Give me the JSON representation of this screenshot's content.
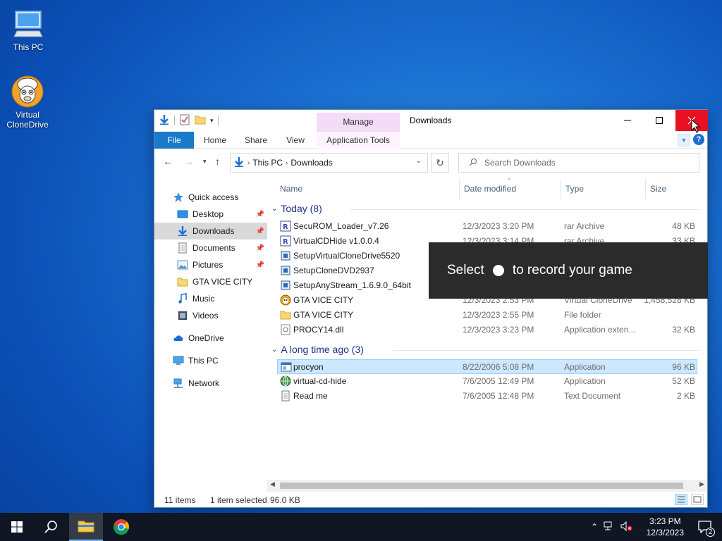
{
  "desktop": {
    "icons": [
      {
        "label": "This PC",
        "icon": "this-pc-icon"
      },
      {
        "label": "Virtual CloneDrive",
        "icon": "sheep-icon"
      }
    ]
  },
  "window": {
    "title": "Downloads",
    "context_tab_group": "Manage",
    "ribbon_tabs": [
      "File",
      "Home",
      "Share",
      "View",
      "Application Tools"
    ],
    "help_label": "?",
    "address": {
      "root": "This PC",
      "current": "Downloads"
    },
    "search_placeholder": "Search Downloads",
    "nav": [
      {
        "label": "Quick access",
        "icon": "star-icon"
      },
      {
        "label": "Desktop",
        "icon": "desktop-folder-icon",
        "pinned": true
      },
      {
        "label": "Downloads",
        "icon": "download-folder-icon",
        "pinned": true,
        "selected": true
      },
      {
        "label": "Documents",
        "icon": "documents-icon",
        "pinned": true
      },
      {
        "label": "Pictures",
        "icon": "pictures-icon",
        "pinned": true
      },
      {
        "label": "GTA VICE CITY",
        "icon": "folder-icon"
      },
      {
        "label": "Music",
        "icon": "music-icon"
      },
      {
        "label": "Videos",
        "icon": "videos-icon"
      },
      {
        "label": "OneDrive",
        "icon": "cloud-icon"
      },
      {
        "label": "This PC",
        "icon": "computer-icon"
      },
      {
        "label": "Network",
        "icon": "network-icon"
      }
    ],
    "columns": [
      "Name",
      "Date modified",
      "Type",
      "Size"
    ],
    "groups": [
      {
        "title": "Today (8)",
        "rows": [
          {
            "name": "SecuROM_Loader_v7.26",
            "date": "12/3/2023 3:20 PM",
            "type": "rar Archive",
            "size": "48 KB",
            "icon": "archive-icon"
          },
          {
            "name": "VirtualCDHide v1.0.0.4",
            "date": "12/3/2023 3:14 PM",
            "type": "rar Archive",
            "size": "33 KB",
            "icon": "archive-icon"
          },
          {
            "name": "SetupVirtualCloneDrive5520",
            "date": "",
            "type": "",
            "size": "",
            "icon": "installer-icon"
          },
          {
            "name": "SetupCloneDVD2937",
            "date": "",
            "type": "",
            "size": "",
            "icon": "installer-icon"
          },
          {
            "name": "SetupAnyStream_1.6.9.0_64bit",
            "date": "",
            "type": "",
            "size": "",
            "icon": "installer-icon"
          },
          {
            "name": "GTA VICE CITY",
            "date": "12/3/2023 2:53 PM",
            "type": "Virtual CloneDrive",
            "size": "1,458,528 KB",
            "icon": "disc-image-icon"
          },
          {
            "name": "GTA VICE CITY",
            "date": "12/3/2023 2:55 PM",
            "type": "File folder",
            "size": "",
            "icon": "folder-icon"
          },
          {
            "name": "PROCY14.dll",
            "date": "12/3/2023 3:23 PM",
            "type": "Application exten...",
            "size": "32 KB",
            "icon": "dll-icon"
          }
        ]
      },
      {
        "title": "A long time ago (3)",
        "rows": [
          {
            "name": "procyon",
            "date": "8/22/2006 5:08 PM",
            "type": "Application",
            "size": "96 KB",
            "icon": "app-window-icon",
            "selected": true
          },
          {
            "name": "virtual-cd-hide",
            "date": "7/6/2005 12:49 PM",
            "type": "Application",
            "size": "52 KB",
            "icon": "globe-app-icon"
          },
          {
            "name": "Read me",
            "date": "7/6/2005 12:48 PM",
            "type": "Text Document",
            "size": "2 KB",
            "icon": "text-document-icon"
          }
        ]
      }
    ],
    "status": {
      "items": "11 items",
      "selected": "1 item selected",
      "size": "96.0 KB"
    }
  },
  "toast": {
    "before": "Select",
    "after": "to record your game"
  },
  "taskbar": {
    "time": "3:23 PM",
    "date": "12/3/2023",
    "notifications": "2"
  },
  "colors": {
    "accent": "#1979ca",
    "close": "#e81123",
    "selection": "#cce8ff",
    "manage_tab": "#f4dbf8"
  }
}
